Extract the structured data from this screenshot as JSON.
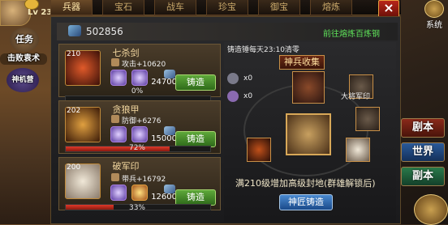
{
  "player": {
    "level": "Lv 23"
  },
  "left_menu": {
    "task": "任务",
    "battle": "击败袁术",
    "shenji": "神机营"
  },
  "tabs": [
    {
      "label": "兵器",
      "active": true
    },
    {
      "label": "宝石"
    },
    {
      "label": "战车"
    },
    {
      "label": "珍宝"
    },
    {
      "label": "御宝"
    },
    {
      "label": "熔炼"
    }
  ],
  "close_label": "×",
  "system_label": "系统",
  "resource": {
    "value": "502856"
  },
  "goto_link": "前往熔炼百炼钢",
  "items": [
    {
      "name": "七杀剑",
      "level": "210",
      "stat": "攻击+10620",
      "cost": "24700",
      "button": "铸造",
      "progress": 0,
      "progress_label": "0%"
    },
    {
      "name": "贪狼甲",
      "level": "202",
      "stat": "防御+6276",
      "cost": "15000",
      "button": "铸造",
      "progress": 72,
      "progress_label": "72%"
    },
    {
      "name": "破军印",
      "level": "200",
      "stat": "带兵+16792",
      "cost": "12600",
      "button": "铸造",
      "progress": 33,
      "progress_label": "33%"
    }
  ],
  "collection": {
    "cast_info": "铸造锤每天23:10清零",
    "title": "神兵收集",
    "hammer_count": "x0",
    "pick_count": "x0",
    "dajiang": "大将军印",
    "bonus_text": "满210级增加高级封地(群雄解锁后)",
    "craft_button": "神匠铸造"
  },
  "side_buttons": {
    "ju": "剧本",
    "shi": "世界",
    "fu": "副本"
  }
}
